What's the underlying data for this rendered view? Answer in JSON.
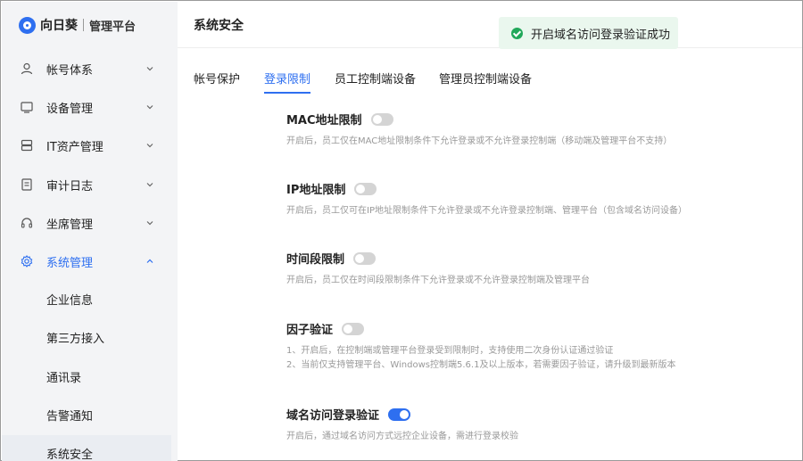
{
  "brand": {
    "name": "向日葵",
    "product": "管理平台"
  },
  "sidebar": {
    "items": [
      {
        "label": "帐号体系",
        "icon": "user-icon"
      },
      {
        "label": "设备管理",
        "icon": "monitor-icon"
      },
      {
        "label": "IT资产管理",
        "icon": "server-icon"
      },
      {
        "label": "审计日志",
        "icon": "document-icon"
      },
      {
        "label": "坐席管理",
        "icon": "headset-icon"
      },
      {
        "label": "系统管理",
        "icon": "gear-icon"
      }
    ],
    "sub_items": [
      {
        "label": "企业信息"
      },
      {
        "label": "第三方接入"
      },
      {
        "label": "通讯录"
      },
      {
        "label": "告警通知"
      },
      {
        "label": "系统安全"
      }
    ]
  },
  "header": {
    "title": "系统安全"
  },
  "toast": {
    "text": "开启域名访问登录验证成功"
  },
  "tabs": [
    {
      "label": "帐号保护"
    },
    {
      "label": "登录限制"
    },
    {
      "label": "员工控制端设备"
    },
    {
      "label": "管理员控制端设备"
    }
  ],
  "settings": [
    {
      "title": "MAC地址限制",
      "enabled": false,
      "desc": [
        "开启后，员工仅在MAC地址限制条件下允许登录或不允许登录控制端（移动端及管理平台不支持）"
      ]
    },
    {
      "title": "IP地址限制",
      "enabled": false,
      "desc": [
        "开启后，员工仅可在IP地址限制条件下允许登录或不允许登录控制端、管理平台（包含域名访问设备）"
      ]
    },
    {
      "title": "时间段限制",
      "enabled": false,
      "desc": [
        "开启后，员工仅在时间段限制条件下允许登录或不允许登录控制端及管理平台"
      ]
    },
    {
      "title": "因子验证",
      "enabled": false,
      "desc": [
        "1、开启后，在控制端或管理平台登录受到限制时，支持使用二次身份认证通过验证",
        "2、当前仅支持管理平台、Windows控制端5.6.1及以上版本，若需要因子验证，请升级到最新版本"
      ]
    },
    {
      "title": "域名访问登录验证",
      "enabled": true,
      "desc": [
        "开启后，通过域名访问方式远控企业设备，需进行登录校验"
      ]
    }
  ],
  "colors": {
    "accent": "#2e6ff0",
    "success": "#21a85a",
    "sidebar_bg": "#f3f4f6"
  }
}
